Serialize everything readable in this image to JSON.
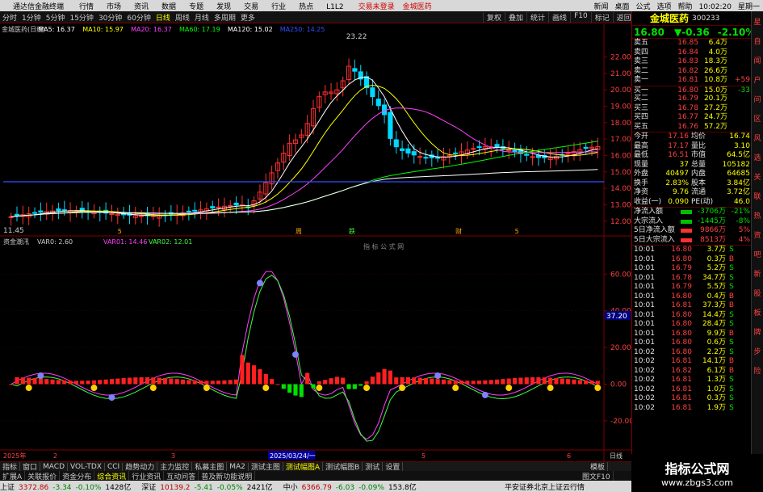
{
  "app": {
    "title": "通达信金融终端"
  },
  "menu": [
    "行情",
    "市场",
    "资讯",
    "数据",
    "专题",
    "发现",
    "交易",
    "行业",
    "热点",
    "L1L2"
  ],
  "alerts": [
    "交易未登录",
    "金城医药"
  ],
  "window_menu": [
    "新闻",
    "桌面",
    "公式",
    "选项",
    "帮助",
    "10:02:20",
    "星期一"
  ],
  "periods": [
    "分时",
    "1分钟",
    "5分钟",
    "15分钟",
    "30分钟",
    "60分钟",
    "日线",
    "周线",
    "月线",
    "多周期",
    "更多"
  ],
  "active_period": "日线",
  "tools": [
    "复权",
    "叠加",
    "统计",
    "画线",
    "F10",
    "标记",
    "返回"
  ],
  "stock": {
    "name": "金城医药",
    "code": "300233",
    "price": "16.80",
    "change": "▼-0.36",
    "pct": "-2.10%"
  },
  "main_legend": {
    "title": "金城医药(日线)",
    "ma5": "MA5: 16.37",
    "ma10": "MA10: 15.97",
    "ma20": "MA20: 16.37",
    "ma60": "MA60: 17.19",
    "ma120": "MA120: 15.02",
    "ma250": "MA250: 14.25"
  },
  "price_axis": [
    "22.00",
    "21.00",
    "20.00",
    "19.00",
    "18.00",
    "17.00",
    "16.00",
    "15.00",
    "14.00",
    "13.00",
    "12.00"
  ],
  "annot_high": "23.22",
  "annot_low": "11.45",
  "event_marks": [
    "5",
    "周",
    "跌",
    "财",
    "5"
  ],
  "sub_legend": {
    "title": "资金潮汛",
    "var0": "VAR0: 2.60",
    "var01": "VAR01: 14.46",
    "var02": "VAR02: 12.01"
  },
  "sub_watermark": "指 标 公 式 网",
  "sub_axis": [
    "60.00",
    "40.00",
    "20.00",
    "0.00",
    "-20.00"
  ],
  "sub_cursor": "37.20",
  "time_axis": [
    "2025年",
    "2",
    "3",
    "2025/03/24/一",
    "5",
    "6"
  ],
  "time_axis_right": "日线",
  "order_book": [
    {
      "label": "卖五",
      "price": "16.85",
      "vol": "6.4万"
    },
    {
      "label": "卖四",
      "price": "16.84",
      "vol": "4.0万"
    },
    {
      "label": "卖三",
      "price": "16.83",
      "vol": "18.3万"
    },
    {
      "label": "卖二",
      "price": "16.82",
      "vol": "26.6万"
    },
    {
      "label": "卖一",
      "price": "16.81",
      "vol": "10.8万",
      "chg": "+59"
    },
    {
      "label": "买一",
      "price": "16.80",
      "vol": "15.0万",
      "chg": "-33"
    },
    {
      "label": "买二",
      "price": "16.79",
      "vol": "20.1万"
    },
    {
      "label": "买三",
      "price": "16.78",
      "vol": "27.2万"
    },
    {
      "label": "买四",
      "price": "16.77",
      "vol": "24.7万"
    },
    {
      "label": "买五",
      "price": "16.76",
      "vol": "57.2万"
    }
  ],
  "stats": [
    {
      "k1": "今开",
      "v1": "17.16",
      "k2": "均价",
      "v2": "16.74"
    },
    {
      "k1": "最高",
      "v1": "17.17",
      "k2": "量比",
      "v2": "3.10"
    },
    {
      "k1": "最低",
      "v1": "16.51",
      "k2": "市值",
      "v2": "64.5亿"
    },
    {
      "k1": "现量",
      "v1": "37",
      "k2": "总量",
      "v2": "105182"
    },
    {
      "k1": "外盘",
      "v1": "40497",
      "k2": "内盘",
      "v2": "64685"
    },
    {
      "k1": "换手",
      "v1": "2.83%",
      "k2": "股本",
      "v2": "3.84亿"
    },
    {
      "k1": "净资",
      "v1": "9.76",
      "k2": "流通",
      "v2": "3.72亿"
    },
    {
      "k1": "收益(一)",
      "v1": "0.090",
      "k2": "PE(动)",
      "v2": "46.0"
    }
  ],
  "flows": [
    {
      "k": "净流入额",
      "v": "-3706万",
      "p": "-21%"
    },
    {
      "k": "大宗流入",
      "v": "-1445万",
      "p": "-8%"
    },
    {
      "k": "5日净流入额",
      "v": "9866万",
      "p": "5%"
    },
    {
      "k": "5日大宗流入",
      "v": "8513万",
      "p": "4%"
    }
  ],
  "ticks": [
    {
      "t": "10:01",
      "p": "16.80",
      "v": "3.7万",
      "s": "S"
    },
    {
      "t": "10:01",
      "p": "16.80",
      "v": "0.3万",
      "s": "B"
    },
    {
      "t": "10:01",
      "p": "16.79",
      "v": "5.2万",
      "s": "S"
    },
    {
      "t": "10:01",
      "p": "16.78",
      "v": "34.7万",
      "s": "S"
    },
    {
      "t": "10:01",
      "p": "16.79",
      "v": "5.5万",
      "s": "S"
    },
    {
      "t": "10:01",
      "p": "16.80",
      "v": "0.4万",
      "s": "B"
    },
    {
      "t": "10:01",
      "p": "16.81",
      "v": "37.3万",
      "s": "B"
    },
    {
      "t": "10:01",
      "p": "16.80",
      "v": "14.4万",
      "s": "S"
    },
    {
      "t": "10:01",
      "p": "16.80",
      "v": "28.4万",
      "s": "S"
    },
    {
      "t": "10:01",
      "p": "16.80",
      "v": "9.9万",
      "s": "B"
    },
    {
      "t": "10:01",
      "p": "16.80",
      "v": "0.6万",
      "s": "S"
    },
    {
      "t": "10:02",
      "p": "16.80",
      "v": "2.2万",
      "s": "S"
    },
    {
      "t": "10:02",
      "p": "16.81",
      "v": "14.1万",
      "s": "B"
    },
    {
      "t": "10:02",
      "p": "16.82",
      "v": "6.1万",
      "s": "B"
    },
    {
      "t": "10:02",
      "p": "16.81",
      "v": "1.3万",
      "s": "S"
    },
    {
      "t": "10:02",
      "p": "16.81",
      "v": "1.0万",
      "s": "S"
    },
    {
      "t": "10:02",
      "p": "16.81",
      "v": "0.3万",
      "s": "S"
    },
    {
      "t": "10:02",
      "p": "16.81",
      "v": "1.9万",
      "s": "S"
    }
  ],
  "tabs1": [
    "指标",
    "窗口",
    "MACD",
    "VOL-TDX",
    "CCI",
    "趋势动力",
    "主力监控",
    "私募主图",
    "MA2",
    "测试主图",
    "测试幅图A",
    "测试幅图B",
    "测试",
    "设置"
  ],
  "tabs1_active": "测试幅图A",
  "tabs1_right": "模板",
  "tabs2": [
    "扩展A",
    "关联报价",
    "资金分布",
    "综合资讯",
    "行业资讯",
    "互动问答",
    "普及新功能说明"
  ],
  "tabs2_right": "图文F10",
  "status": [
    {
      "name": "上证",
      "val": "3372.86",
      "chg": "-3.34",
      "pct": "-0.10%",
      "amt": "1428亿"
    },
    {
      "name": "深证",
      "val": "10139.2",
      "chg": "-5.41",
      "pct": "-0.05%",
      "amt": "2421亿"
    },
    {
      "name": "中小",
      "val": "6366.79",
      "chg": "-6.03",
      "pct": "-0.09%",
      "amt": "153.8亿"
    }
  ],
  "broker": "平安证券北京上证云行情",
  "logo": {
    "title": "指标公式网",
    "url": "www.zbgs3.com"
  },
  "colors": {
    "up": "#ff3030",
    "down": "#00d8ff",
    "ma5": "#ffffff",
    "ma10": "#ffff00",
    "ma20": "#ff40ff",
    "ma60": "#00ff00",
    "ma120": "#ffffff",
    "ma250": "#3050ff"
  },
  "side_icons": [
    "星",
    "自",
    "闻",
    "户",
    "问",
    "区",
    "风",
    "选",
    "关",
    "联",
    "热",
    "资",
    "吧",
    "新",
    "股",
    "板",
    "牌",
    "步",
    "险"
  ]
}
